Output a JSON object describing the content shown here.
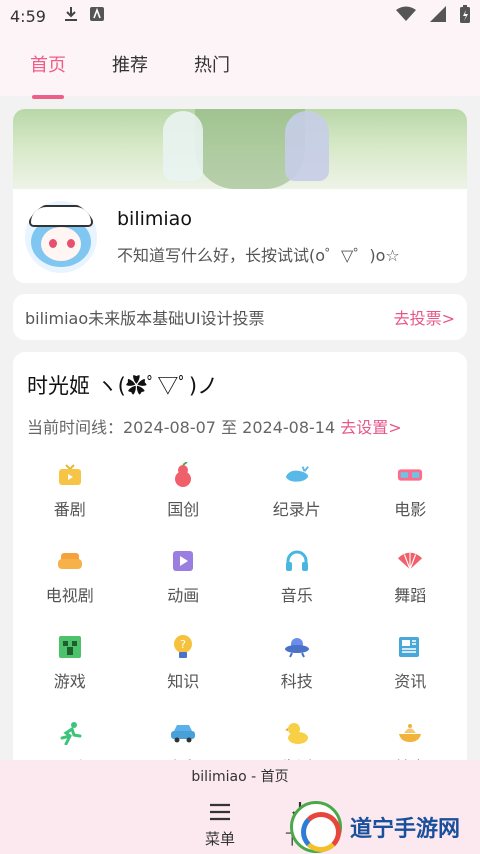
{
  "status_bar": {
    "time": "4:59"
  },
  "tabs": [
    {
      "label": "首页",
      "active": true
    },
    {
      "label": "推荐",
      "active": false
    },
    {
      "label": "热门",
      "active": false
    }
  ],
  "profile": {
    "name": "bilimiao",
    "signature": "不知道写什么好，长按试试(o゜▽゜)o☆"
  },
  "vote": {
    "text": "bilimiao未来版本基础UI设计投票",
    "link": "去投票>"
  },
  "timeline_card": {
    "title": "时光姬 ヽ(✿ﾟ▽ﾟ)ノ",
    "range_label": "当前时间线：2024-08-07 至 2024-08-14",
    "set_link": "去设置>",
    "categories": [
      {
        "label": "番剧",
        "icon": "tv-icon"
      },
      {
        "label": "国创",
        "icon": "gourd-icon"
      },
      {
        "label": "纪录片",
        "icon": "whale-icon"
      },
      {
        "label": "电影",
        "icon": "3d-glasses-icon"
      },
      {
        "label": "电视剧",
        "icon": "sofa-icon"
      },
      {
        "label": "动画",
        "icon": "play-icon"
      },
      {
        "label": "音乐",
        "icon": "headphones-icon"
      },
      {
        "label": "舞蹈",
        "icon": "fan-icon"
      },
      {
        "label": "游戏",
        "icon": "creeper-icon"
      },
      {
        "label": "知识",
        "icon": "bulb-icon"
      },
      {
        "label": "科技",
        "icon": "ufo-icon"
      },
      {
        "label": "资讯",
        "icon": "newspaper-icon"
      },
      {
        "label": "运动",
        "icon": "runner-icon"
      },
      {
        "label": "汽车",
        "icon": "car-icon"
      },
      {
        "label": "生活",
        "icon": "duck-icon"
      },
      {
        "label": "美食",
        "icon": "food-icon"
      }
    ]
  },
  "bottom_bar": {
    "title": "bilimiao - 首页",
    "menu_label": "菜单",
    "download_label": "下载"
  },
  "watermark": {
    "text": "道宁手游网"
  },
  "colors": {
    "accent": "#f05d87",
    "link": "#e8578a",
    "topbar": "#fdf4f7"
  }
}
